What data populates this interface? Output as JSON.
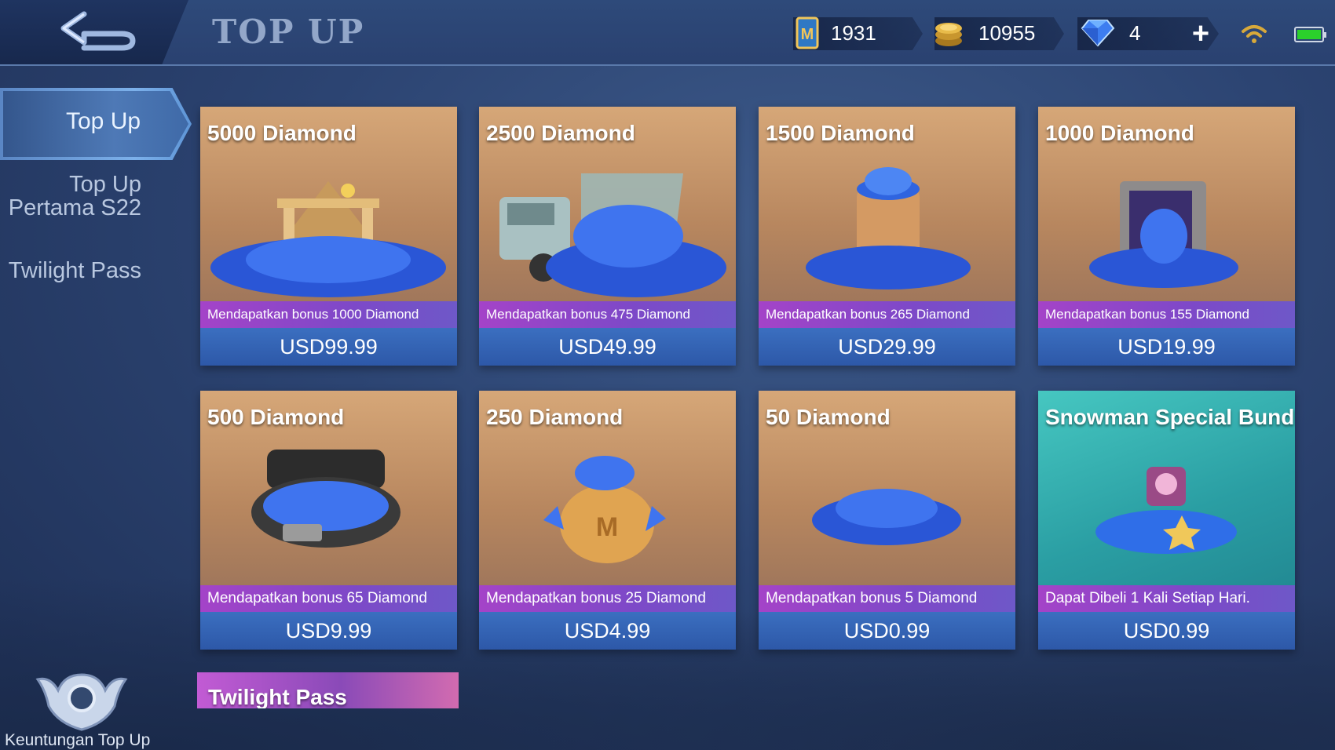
{
  "header": {
    "title": "TOP UP",
    "back_icon": "back-arrow-icon",
    "resources": [
      {
        "name": "ticket",
        "icon": "ticket-icon",
        "value": "1931"
      },
      {
        "name": "battle-points",
        "icon": "gold-coin-icon",
        "value": "10955"
      },
      {
        "name": "diamonds",
        "icon": "diamond-icon",
        "value": "4"
      }
    ],
    "plus_label": "+",
    "battery_level": 1.0
  },
  "sidebar": {
    "items": [
      {
        "label": "Top Up",
        "active": true
      },
      {
        "label": "Top Up Pertama S22",
        "active": false
      },
      {
        "label": "Twilight Pass",
        "active": false
      }
    ],
    "benefit_label": "Keuntungan Top Up"
  },
  "cards": [
    {
      "title": "5000 Diamond",
      "bonus": "Mendapatkan bonus 1000 Diamond",
      "price": "USD99.99",
      "art": "bank-diamonds"
    },
    {
      "title": "2500 Diamond",
      "bonus": "Mendapatkan bonus 475 Diamond",
      "price": "USD49.99",
      "art": "truck-diamonds"
    },
    {
      "title": "1500 Diamond",
      "bonus": "Mendapatkan bonus 265 Diamond",
      "price": "USD29.99",
      "art": "barrel-diamonds"
    },
    {
      "title": "1000 Diamond",
      "bonus": "Mendapatkan bonus 155 Diamond",
      "price": "USD19.99",
      "art": "safe-diamonds"
    },
    {
      "title": "500 Diamond",
      "bonus": "Mendapatkan bonus 65 Diamond",
      "price": "USD9.99",
      "art": "chest-diamonds"
    },
    {
      "title": "250 Diamond",
      "bonus": "Mendapatkan bonus 25 Diamond",
      "price": "USD4.99",
      "art": "bag-diamonds"
    },
    {
      "title": "50 Diamond",
      "bonus": "Mendapatkan bonus 5 Diamond",
      "price": "USD0.99",
      "art": "pile-diamonds"
    },
    {
      "title": "Snowman Special Bundle",
      "bonus": "Dapat Dibeli 1 Kali Setiap Hari.",
      "price": "USD0.99",
      "art": "bundle-diamonds"
    }
  ],
  "twilight_card": {
    "title": "Twilight Pass"
  },
  "colors": {
    "bonus_strip": "#a443c8",
    "price_strip": "#3b6fc0",
    "card_gold": "#d6a778",
    "card_teal": "#46c7c1"
  }
}
